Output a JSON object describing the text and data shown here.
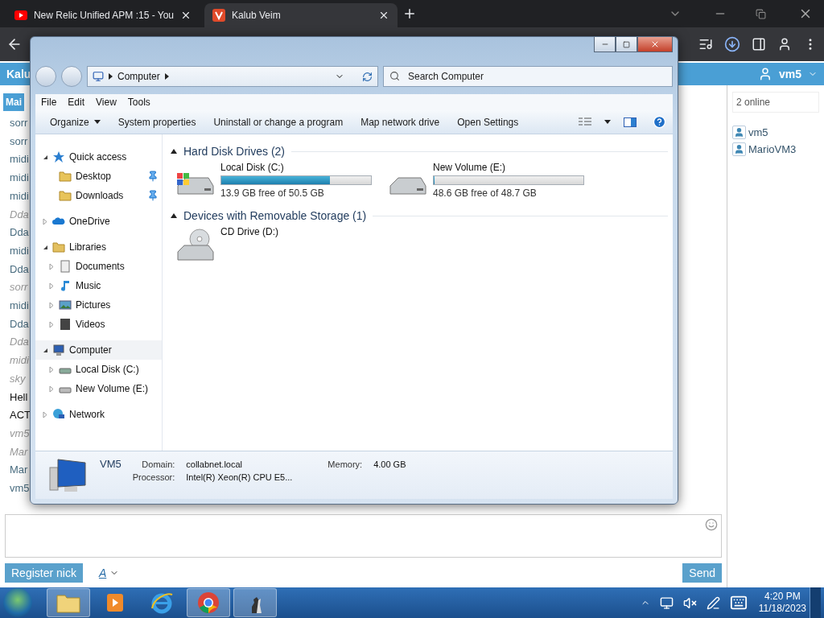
{
  "browser": {
    "tabs": [
      {
        "title": "New Relic Unified APM :15 - You",
        "kind": "video",
        "selected": false
      },
      {
        "title": "Kalub Veim",
        "kind": "site",
        "selected": true
      }
    ]
  },
  "chat": {
    "site_title": "Kalu",
    "user": "vm5",
    "room_tab": "Mai",
    "messages": [
      {
        "text": "sorr",
        "kind": "nick"
      },
      {
        "text": "sorr",
        "kind": "nick"
      },
      {
        "text": "midi",
        "kind": "nick"
      },
      {
        "text": "midi",
        "kind": "nick"
      },
      {
        "text": "midi",
        "kind": "nick"
      },
      {
        "text": "Dda",
        "kind": "notice"
      },
      {
        "text": "Dda",
        "kind": "nick"
      },
      {
        "text": "midi",
        "kind": "nick"
      },
      {
        "text": "Dda",
        "kind": "nick"
      },
      {
        "text": "sorr",
        "kind": "notice"
      },
      {
        "text": "midi",
        "kind": "nick"
      },
      {
        "text": "Dda",
        "kind": "nick"
      },
      {
        "text": "Dda",
        "kind": "notice"
      },
      {
        "text": "midi",
        "kind": "notice"
      },
      {
        "text": "sky",
        "kind": "notice"
      },
      {
        "text": "Hell",
        "kind": "plain"
      },
      {
        "text": "ACT",
        "kind": "plain"
      },
      {
        "text": "vm5",
        "kind": "notice"
      },
      {
        "text": "Mar",
        "kind": "notice"
      },
      {
        "text": "Mar",
        "kind": "nick"
      },
      {
        "text": "vm5",
        "kind": "nick"
      }
    ],
    "online_count": "2 online",
    "users": [
      "vm5",
      "MarioVM3"
    ],
    "register_button": "Register nick",
    "font_button": "A",
    "send_button": "Send"
  },
  "explorer": {
    "address": "Computer",
    "search": {
      "placeholder": "Search Computer"
    },
    "menu": [
      "File",
      "Edit",
      "View",
      "Tools"
    ],
    "commands": [
      {
        "label": "Organize",
        "kind": "menu"
      },
      {
        "label": "System properties",
        "kind": "plain"
      },
      {
        "label": "Uninstall or change a program",
        "kind": "plain"
      },
      {
        "label": "Map network drive",
        "kind": "plain"
      },
      {
        "label": "Open Settings",
        "kind": "plain"
      }
    ],
    "tree": [
      {
        "label": "Quick access",
        "kind": "star",
        "expanded": true,
        "selected": false,
        "children": [
          {
            "label": "Desktop",
            "kind": "desktop",
            "pinned": true,
            "selected": false
          },
          {
            "label": "Downloads",
            "kind": "downloads",
            "pinned": true,
            "selected": false
          }
        ]
      },
      {
        "label": "OneDrive",
        "kind": "cloud",
        "expanded": false,
        "selected": false
      },
      {
        "label": "Libraries",
        "kind": "library",
        "expanded": true,
        "selected": false,
        "children": [
          {
            "label": "Documents",
            "kind": "document",
            "expanded": false,
            "selected": false
          },
          {
            "label": "Music",
            "kind": "music",
            "expanded": false,
            "selected": false
          },
          {
            "label": "Pictures",
            "kind": "picture",
            "expanded": false,
            "selected": false
          },
          {
            "label": "Videos",
            "kind": "video",
            "expanded": false,
            "selected": false
          }
        ]
      },
      {
        "label": "Computer",
        "kind": "computer",
        "expanded": true,
        "selected": true,
        "children": [
          {
            "label": "Local Disk (C:)",
            "kind": "system-disk",
            "expanded": false,
            "selected": false
          },
          {
            "label": "New Volume (E:)",
            "kind": "disk",
            "expanded": false,
            "selected": false
          }
        ]
      },
      {
        "label": "Network",
        "kind": "network",
        "expanded": false,
        "selected": false
      }
    ],
    "groups": [
      {
        "title": "Hard Disk Drives (2)",
        "expanded": true,
        "items": [
          {
            "name": "Local Disk (C:)",
            "kind": "system-disk",
            "level": 0.725,
            "space": "13.9 GB free of 50.5 GB"
          },
          {
            "name": "New Volume (E:)",
            "kind": "disk",
            "level": 0.003,
            "space": "48.6 GB free of 48.7 GB"
          }
        ]
      },
      {
        "title": "Devices with Removable Storage (1)",
        "expanded": true,
        "items": [
          {
            "name": "CD Drive (D:)",
            "kind": "optical"
          }
        ]
      }
    ],
    "details": {
      "name": "VM5",
      "fields": [
        {
          "label": "Domain:",
          "value": "collabnet.local"
        },
        {
          "label": "Memory:",
          "value": "4.00 GB"
        },
        {
          "label": "Processor:",
          "value": "Intel(R) Xeon(R) CPU E5..."
        }
      ]
    }
  },
  "taskbar": {
    "apps": [
      {
        "kind": "explorer",
        "active": true
      },
      {
        "kind": "media",
        "active": false
      },
      {
        "kind": "ie",
        "active": false
      },
      {
        "kind": "chrome",
        "active": true
      },
      {
        "kind": "chess",
        "active": true
      }
    ],
    "time": "4:20 PM",
    "date": "11/18/2023"
  }
}
